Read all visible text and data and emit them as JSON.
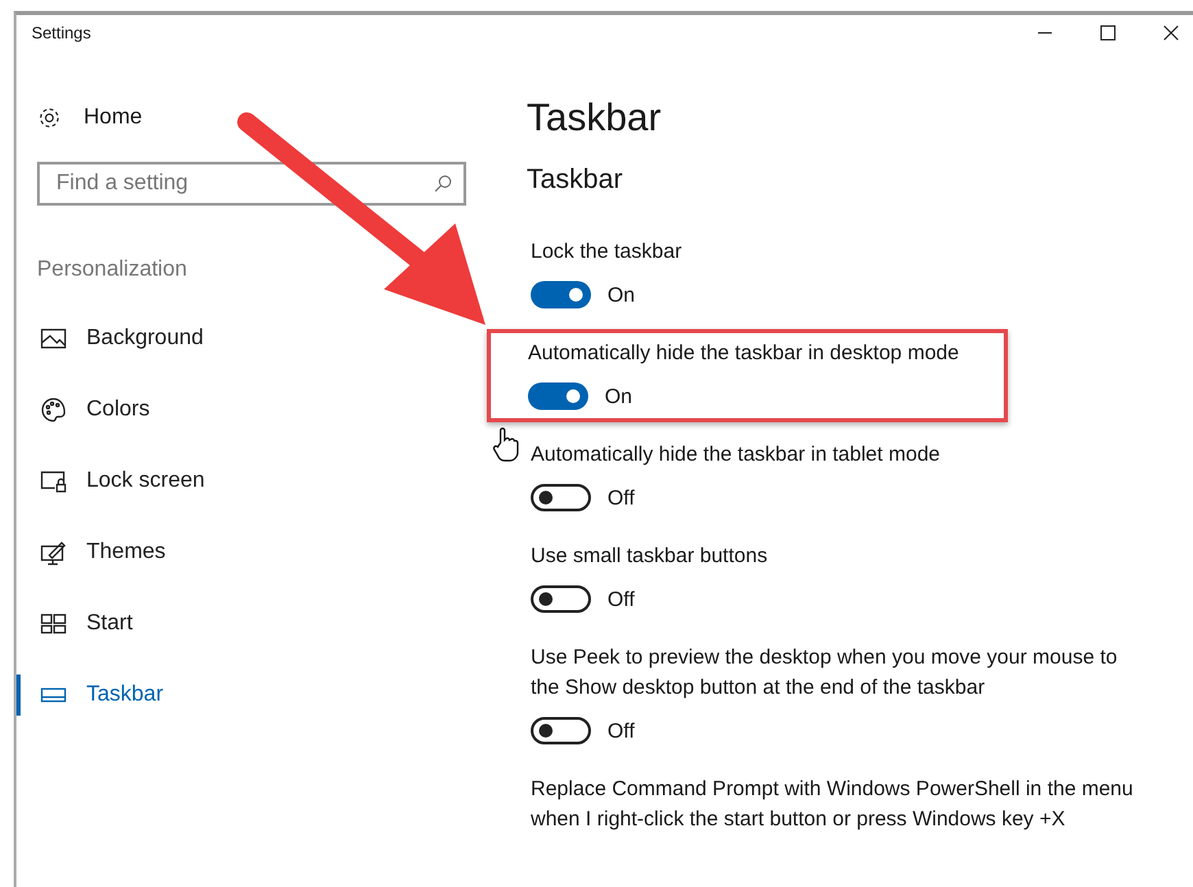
{
  "window": {
    "title": "Settings"
  },
  "sidebar": {
    "home": "Home",
    "search": {
      "placeholder": "Find a setting"
    },
    "section": "Personalization",
    "items": [
      {
        "label": "Background",
        "selected": false
      },
      {
        "label": "Colors",
        "selected": false
      },
      {
        "label": "Lock screen",
        "selected": false
      },
      {
        "label": "Themes",
        "selected": false
      },
      {
        "label": "Start",
        "selected": false
      },
      {
        "label": "Taskbar",
        "selected": true
      }
    ]
  },
  "page": {
    "title": "Taskbar",
    "section": "Taskbar",
    "settings": [
      {
        "label": "Lock the taskbar",
        "on": true,
        "state": "On",
        "highlighted": false
      },
      {
        "label": "Automatically hide the taskbar in desktop mode",
        "on": true,
        "state": "On",
        "highlighted": true
      },
      {
        "label": "Automatically hide the taskbar in tablet mode",
        "on": false,
        "state": "Off",
        "highlighted": false
      },
      {
        "label": "Use small taskbar buttons",
        "on": false,
        "state": "Off",
        "highlighted": false
      },
      {
        "label": "Use Peek to preview the desktop when you move your mouse to the Show desktop button at the end of the taskbar",
        "on": false,
        "state": "Off",
        "highlighted": false
      },
      {
        "label": "Replace Command Prompt with Windows PowerShell in the menu when I right-click the start button or press Windows key +X",
        "highlighted": false
      }
    ]
  }
}
